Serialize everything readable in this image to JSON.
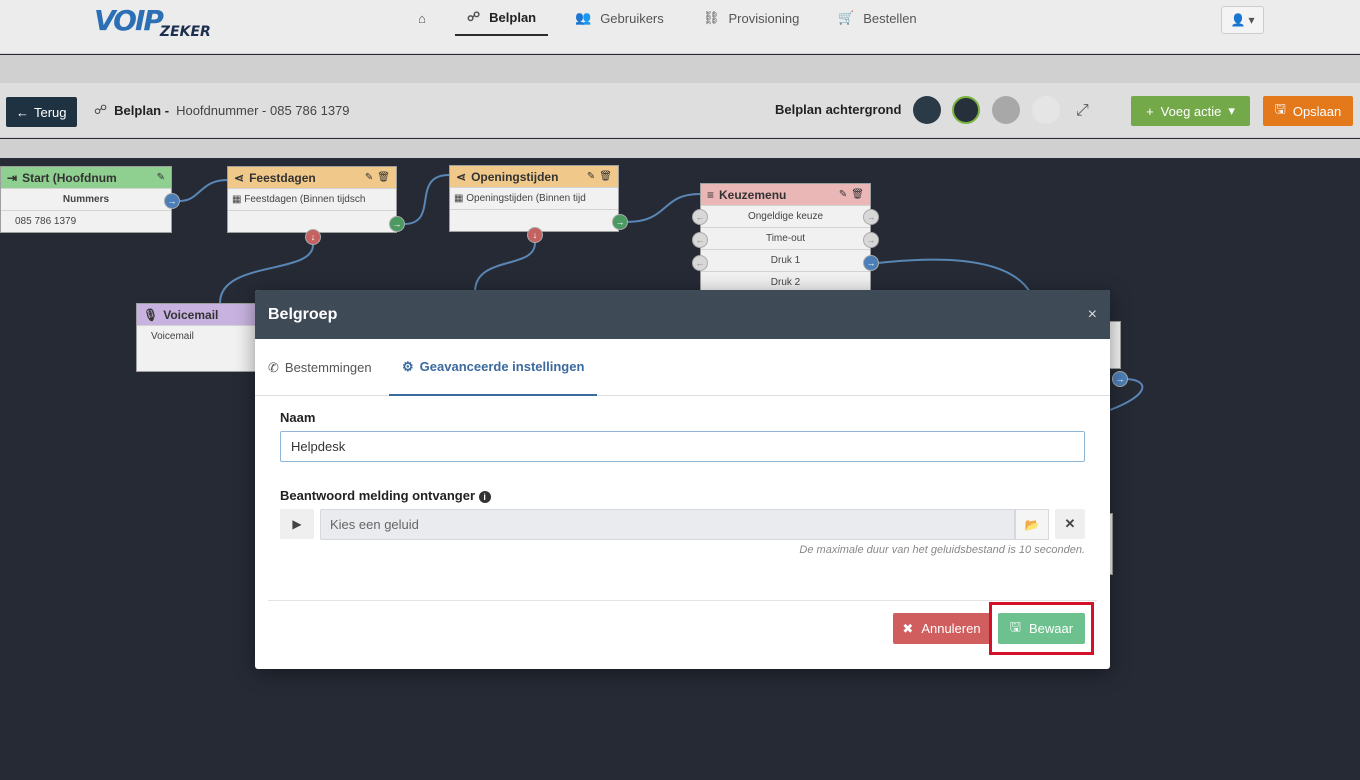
{
  "brand": {
    "logo_main": "VOIP",
    "logo_sub": "ZEKER"
  },
  "nav": {
    "home_icon": "home-icon",
    "items": [
      {
        "label": "Belplan",
        "icon": "sitemap-icon",
        "active": true
      },
      {
        "label": "Gebruikers",
        "icon": "users-icon"
      },
      {
        "label": "Provisioning",
        "icon": "network-icon"
      },
      {
        "label": "Bestellen",
        "icon": "cart-icon"
      }
    ],
    "user_icon": "user-icon"
  },
  "toolbar": {
    "back_label": "Terug",
    "breadcrumb_title": "Belplan -",
    "breadcrumb_sub": "Hoofdnummer - 085 786 1379",
    "bg_label": "Belplan achtergrond",
    "bg_colors": [
      "#2b3a47",
      "#26303a",
      "#a8a8a8",
      "#e5e5e5"
    ],
    "add_action_label": "Voeg actie",
    "save_label": "Opslaan"
  },
  "nodes": {
    "start": {
      "title": "Start (Hoofdnum",
      "header": "Nummers",
      "row": "085 786 1379",
      "color": "#8fcf8f"
    },
    "feestdagen": {
      "title": "Feestdagen",
      "row": "Feestdagen (Binnen tijdsch",
      "color": "#f0c98a"
    },
    "openingstijden": {
      "title": "Openingstijden",
      "row": "Openingstijden (Binnen tijd",
      "color": "#f0c98a"
    },
    "keuzemenu": {
      "title": "Keuzemenu",
      "rows": [
        "Ongeldige keuze",
        "Time-out",
        "Druk 1",
        "Druk 2"
      ],
      "color": "#eab6b6"
    },
    "voicemail": {
      "title": "Voicemail",
      "row": "Voicemail",
      "color": "#c8b3e0"
    }
  },
  "modal": {
    "title": "Belgroep",
    "close": "×",
    "tabs": [
      {
        "label": "Bestemmingen",
        "icon": "phone-icon"
      },
      {
        "label": "Geavanceerde instellingen",
        "icon": "gear-icon",
        "active": true
      }
    ],
    "name_label": "Naam",
    "name_value": "Helpdesk",
    "answer_label": "Beantwoord melding ontvanger",
    "sound_placeholder": "Kies een geluid",
    "hint": "De maximale duur van het geluidsbestand is 10 seconden.",
    "cancel_label": "Annuleren",
    "save_label": "Bewaar"
  }
}
